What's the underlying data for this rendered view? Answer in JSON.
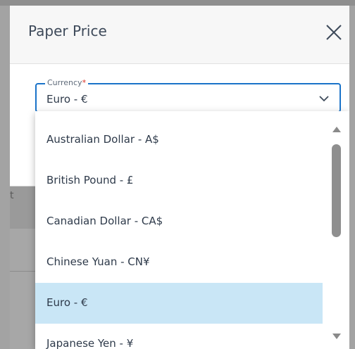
{
  "dialog": {
    "title": "Paper Price"
  },
  "currency_field": {
    "label": "Currency",
    "required_marker": "*",
    "value": "Euro - €"
  },
  "dropdown": {
    "options": [
      {
        "label": "Australian Dollar - A$"
      },
      {
        "label": "British Pound - £"
      },
      {
        "label": "Canadian Dollar - CA$"
      },
      {
        "label": "Chinese Yuan - CN¥"
      },
      {
        "label": "Euro - €"
      },
      {
        "label": "Japanese Yen - ¥"
      }
    ],
    "selected_option": "Euro - €"
  },
  "background": {
    "partial_text": "t"
  },
  "icons": {
    "close": "close-icon",
    "chevron": "chevron-down-icon",
    "scroll_up": "scroll-up-arrow",
    "scroll_down": "scroll-down-arrow"
  },
  "colors": {
    "accent": "#1a73c9",
    "selected_background": "#c9e6f6",
    "backdrop": "#9a9a9a",
    "button_dark": "#0f4e7a"
  }
}
